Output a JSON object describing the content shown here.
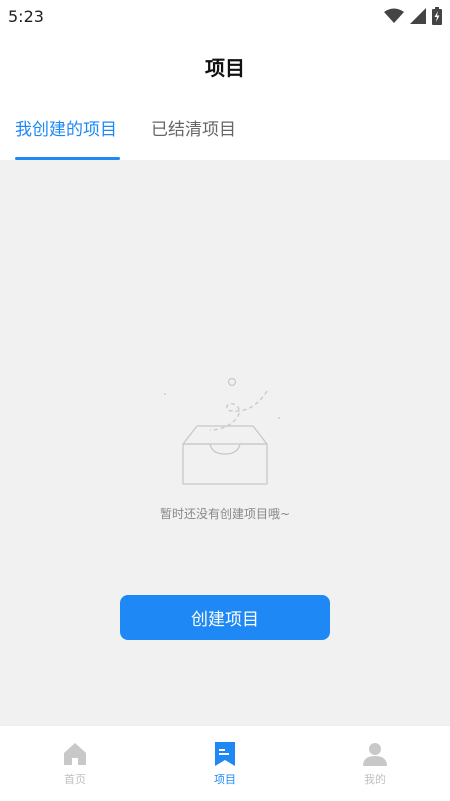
{
  "status_bar": {
    "time": "5:23"
  },
  "header": {
    "title": "项目"
  },
  "tabs": [
    {
      "label": "我创建的项目",
      "active": true
    },
    {
      "label": "已结清项目",
      "active": false
    }
  ],
  "empty_state": {
    "message": "暂时还没有创建项目哦~"
  },
  "create_button": {
    "label": "创建项目"
  },
  "bottom_nav": [
    {
      "label": "首页",
      "icon": "home-icon",
      "active": false
    },
    {
      "label": "项目",
      "icon": "project-bookmark-icon",
      "active": true
    },
    {
      "label": "我的",
      "icon": "user-icon",
      "active": false
    }
  ],
  "colors": {
    "accent": "#1E88F5",
    "content_background": "#f1f1f1",
    "inactive": "#c0c0c0"
  }
}
